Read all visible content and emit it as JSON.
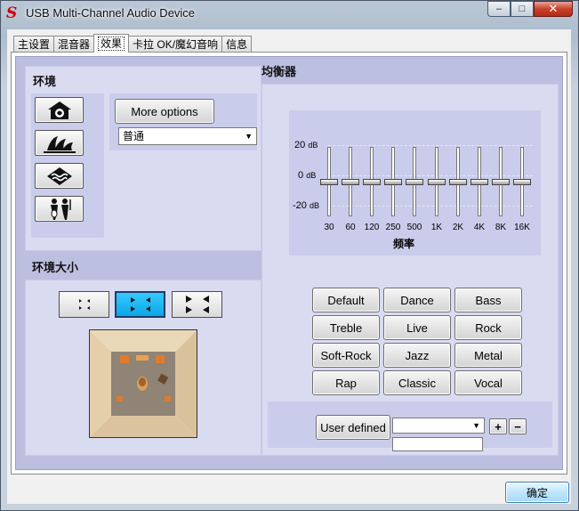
{
  "window": {
    "title": "USB Multi-Channel Audio Device",
    "logo_letter": "S",
    "minimize_glyph": "–",
    "maximize_glyph": "□",
    "close_glyph": "✕"
  },
  "tabs": [
    {
      "label": "主设置",
      "active": false
    },
    {
      "label": "混音器",
      "active": false
    },
    {
      "label": "效果",
      "active": true
    },
    {
      "label": "卡拉 OK/魔幻音响",
      "active": false
    },
    {
      "label": "信息",
      "active": false
    }
  ],
  "environment": {
    "title": "环境",
    "more_options_label": "More options",
    "selected_environment": "普通",
    "icons": [
      "room-icon",
      "opera-house-icon",
      "underwater-icon",
      "concert-icon"
    ]
  },
  "environment_size": {
    "title": "环境大小",
    "sizes": [
      "small-room-icon",
      "medium-room-icon",
      "large-room-icon"
    ],
    "selected_index": 1
  },
  "equalizer": {
    "title": "均衡器",
    "db_labels": [
      {
        "value": "20",
        "unit": "dB"
      },
      {
        "value": "0",
        "unit": "dB"
      },
      {
        "value": "-20",
        "unit": "dB"
      }
    ],
    "frequency_title": "频率",
    "bands": [
      {
        "freq": "30",
        "gain_db": 0
      },
      {
        "freq": "60",
        "gain_db": 0
      },
      {
        "freq": "120",
        "gain_db": 0
      },
      {
        "freq": "250",
        "gain_db": 0
      },
      {
        "freq": "500",
        "gain_db": 0
      },
      {
        "freq": "1K",
        "gain_db": 0
      },
      {
        "freq": "2K",
        "gain_db": 0
      },
      {
        "freq": "4K",
        "gain_db": 0
      },
      {
        "freq": "8K",
        "gain_db": 0
      },
      {
        "freq": "16K",
        "gain_db": 0
      }
    ],
    "presets": [
      "Default",
      "Dance",
      "Bass",
      "Treble",
      "Live",
      "Rock",
      "Soft-Rock",
      "Jazz",
      "Metal",
      "Rap",
      "Classic",
      "Vocal"
    ],
    "user_defined_label": "User defined",
    "user_defined_selected": "",
    "user_defined_name": "",
    "add_glyph": "+",
    "remove_glyph": "−"
  },
  "footer": {
    "ok_label": "确定"
  }
}
